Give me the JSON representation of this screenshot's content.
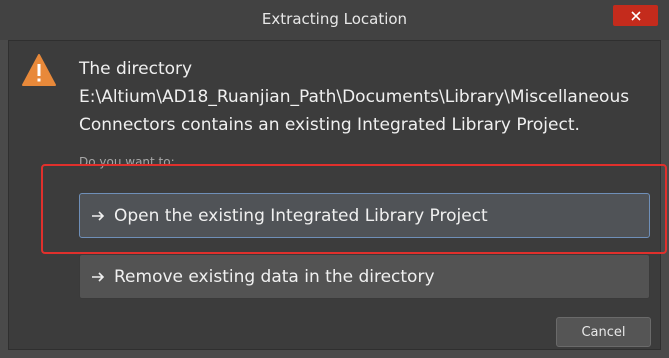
{
  "window": {
    "title": "Extracting Location",
    "close_icon": "close-icon"
  },
  "message": {
    "icon": "warning-icon",
    "line1": "The directory",
    "line2": "E:\\Altium\\AD18_Ruanjian_Path\\Documents\\Library\\Miscellaneous",
    "line3": "Connectors contains an existing Integrated Library Project."
  },
  "question": "Do you want to:",
  "options": [
    {
      "label": "Open the existing Integrated Library Project",
      "icon": "arrow-right-icon"
    },
    {
      "label": "Remove existing data in the directory",
      "icon": "arrow-right-icon"
    }
  ],
  "buttons": {
    "cancel": "Cancel"
  },
  "colors": {
    "highlight": "#e0302c",
    "warning": "#e8893a",
    "close": "#c42b1c"
  }
}
